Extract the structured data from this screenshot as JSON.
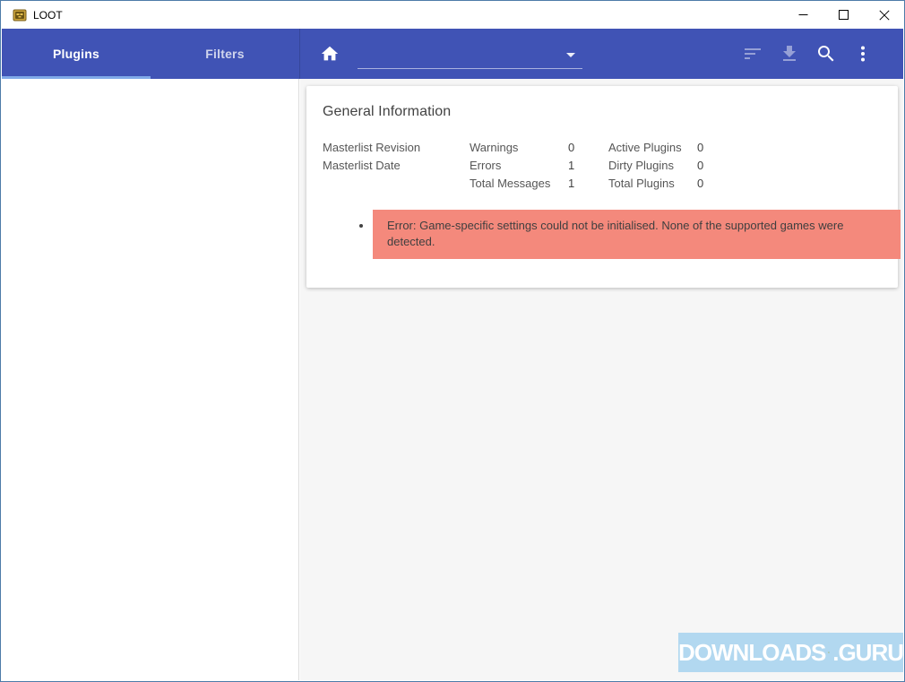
{
  "window": {
    "title": "LOOT",
    "controls": {
      "minimize": "minimize",
      "maximize": "maximize",
      "close": "close"
    }
  },
  "toolbar": {
    "tabs": [
      {
        "label": "Plugins",
        "active": true
      },
      {
        "label": "Filters",
        "active": false
      }
    ],
    "game_select": {
      "selected_value": ""
    },
    "actions": [
      "sort-plugins",
      "update-masterlist",
      "search",
      "main-menu"
    ]
  },
  "general_info": {
    "title": "General Information",
    "masterlist": [
      {
        "label": "Masterlist Revision",
        "value": ""
      },
      {
        "label": "Masterlist Date",
        "value": ""
      }
    ],
    "counts": [
      {
        "label": "Warnings",
        "value": "0"
      },
      {
        "label": "Errors",
        "value": "1"
      },
      {
        "label": "Total Messages",
        "value": "1"
      }
    ],
    "plugins": [
      {
        "label": "Active Plugins",
        "value": "0"
      },
      {
        "label": "Dirty Plugins",
        "value": "0"
      },
      {
        "label": "Total Plugins",
        "value": "0"
      }
    ],
    "messages": [
      {
        "type": "error",
        "text": "Error: Game-specific settings could not be initialised. None of the supported games were detected."
      }
    ]
  },
  "watermark": {
    "brand_left": "DOWNLOADS",
    "brand_right": ".GURU"
  },
  "icons": {
    "app": "loot-gold-chest",
    "home": "home",
    "game_select_caret": "caret-down",
    "sort": "sort-lines",
    "update_masterlist": "download-arrow",
    "search": "magnifier",
    "menu": "vertical-dots",
    "minimize": "horizontal-line",
    "maximize": "square-outline",
    "close": "x-cross",
    "watermark": "download-plant-arrow"
  },
  "colors": {
    "toolbar": "#4053b5",
    "tab_underline": "#80aae8",
    "error_bg": "#f4897c",
    "main_bg": "#f6f6f6",
    "window_border": "#4d7ba8",
    "watermark_bg": "#b2d8f0"
  }
}
